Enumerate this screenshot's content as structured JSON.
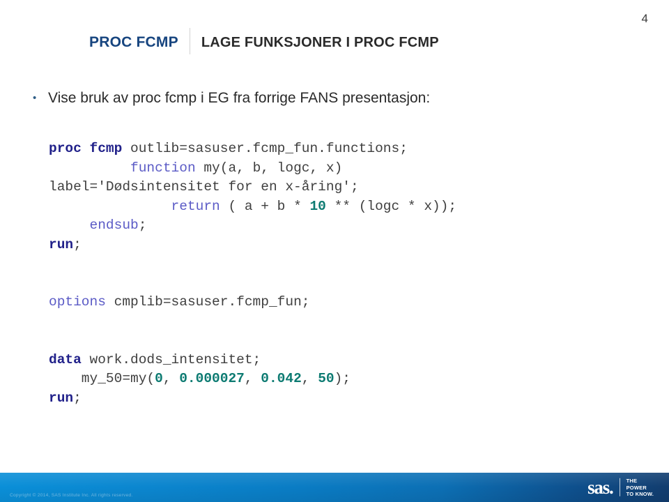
{
  "slide": {
    "page_number": "4",
    "header": {
      "brand": "PROC FCMP",
      "title": "LAGE FUNKSJONER I PROC FCMP"
    },
    "bullet": {
      "marker": "•",
      "text": "Vise bruk av proc fcmp i EG fra forrige FANS presentasjon:"
    },
    "code": {
      "language": "SAS",
      "lines": [
        {
          "id": "line-1",
          "tokens": [
            {
              "type": "keyword-bold",
              "text": "proc fcmp"
            },
            {
              "type": "plain",
              "text": " outlib=sasuser.fcmp_fun.functions;"
            }
          ]
        },
        {
          "id": "line-2",
          "tokens": [
            {
              "type": "plain",
              "text": "          "
            },
            {
              "type": "keyword",
              "text": "function"
            },
            {
              "type": "plain",
              "text": " my(a, b, logc, x)"
            }
          ]
        },
        {
          "id": "line-3",
          "tokens": [
            {
              "type": "plain",
              "text": "label='Dødsintensitet for en x-åring';"
            }
          ]
        },
        {
          "id": "line-4",
          "tokens": [
            {
              "type": "plain",
              "text": "               "
            },
            {
              "type": "keyword",
              "text": "return"
            },
            {
              "type": "plain",
              "text": " ( a + b * "
            },
            {
              "type": "number",
              "text": "10"
            },
            {
              "type": "plain",
              "text": " ** (logc * x));"
            }
          ]
        },
        {
          "id": "line-5",
          "tokens": [
            {
              "type": "plain",
              "text": "     "
            },
            {
              "type": "keyword",
              "text": "endsub"
            },
            {
              "type": "plain",
              "text": ";"
            }
          ]
        },
        {
          "id": "line-6",
          "tokens": [
            {
              "type": "keyword-bold",
              "text": "run"
            },
            {
              "type": "plain",
              "text": ";"
            }
          ]
        },
        {
          "id": "line-7",
          "tokens": []
        },
        {
          "id": "line-8",
          "tokens": []
        },
        {
          "id": "line-9",
          "tokens": [
            {
              "type": "keyword",
              "text": "options"
            },
            {
              "type": "plain",
              "text": " cmplib=sasuser.fcmp_fun;"
            }
          ]
        },
        {
          "id": "line-10",
          "tokens": []
        },
        {
          "id": "line-11",
          "tokens": []
        },
        {
          "id": "line-12",
          "tokens": [
            {
              "type": "keyword-bold",
              "text": "data"
            },
            {
              "type": "plain",
              "text": " work.dods_intensitet;"
            }
          ]
        },
        {
          "id": "line-13",
          "tokens": [
            {
              "type": "plain",
              "text": "    my_50=my("
            },
            {
              "type": "number",
              "text": "0"
            },
            {
              "type": "plain",
              "text": ", "
            },
            {
              "type": "number",
              "text": "0.000027"
            },
            {
              "type": "plain",
              "text": ", "
            },
            {
              "type": "number",
              "text": "0.042"
            },
            {
              "type": "plain",
              "text": ", "
            },
            {
              "type": "number",
              "text": "50"
            },
            {
              "type": "plain",
              "text": ");"
            }
          ]
        },
        {
          "id": "line-14",
          "tokens": [
            {
              "type": "keyword-bold",
              "text": "run"
            },
            {
              "type": "plain",
              "text": ";"
            }
          ]
        }
      ]
    },
    "footer": {
      "copyright": "Copyright © 2014, SAS Institute Inc. All rights reserved.",
      "logo_text": "sas",
      "logo_dot": ".",
      "tagline_line1": "THE",
      "tagline_line2": "POWER",
      "tagline_line3": "TO KNOW."
    },
    "colors": {
      "brand_blue": "#17457f",
      "title_dark": "#2a2a2a",
      "code_keyword_bold": "#21218a",
      "code_keyword": "#5b5bc6",
      "code_number": "#0d7b72",
      "code_plain": "#3f3f3f",
      "footer_blue_light": "#0a8fd8",
      "footer_blue_dark": "#123c6d"
    }
  }
}
